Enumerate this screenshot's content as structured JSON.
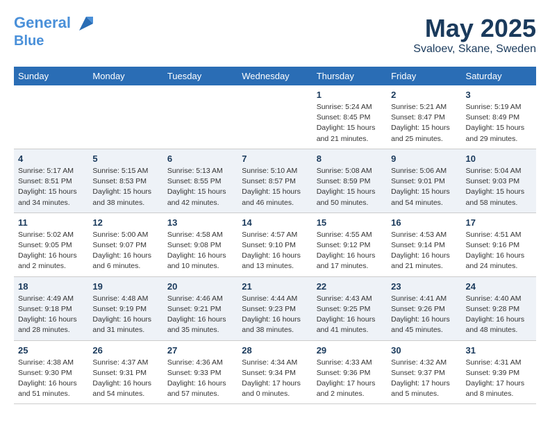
{
  "header": {
    "logo_line1": "General",
    "logo_line2": "Blue",
    "month_title": "May 2025",
    "location": "Svaloev, Skane, Sweden"
  },
  "columns": [
    "Sunday",
    "Monday",
    "Tuesday",
    "Wednesday",
    "Thursday",
    "Friday",
    "Saturday"
  ],
  "weeks": [
    [
      {
        "day": "",
        "info": ""
      },
      {
        "day": "",
        "info": ""
      },
      {
        "day": "",
        "info": ""
      },
      {
        "day": "",
        "info": ""
      },
      {
        "day": "1",
        "info": "Sunrise: 5:24 AM\nSunset: 8:45 PM\nDaylight: 15 hours\nand 21 minutes."
      },
      {
        "day": "2",
        "info": "Sunrise: 5:21 AM\nSunset: 8:47 PM\nDaylight: 15 hours\nand 25 minutes."
      },
      {
        "day": "3",
        "info": "Sunrise: 5:19 AM\nSunset: 8:49 PM\nDaylight: 15 hours\nand 29 minutes."
      }
    ],
    [
      {
        "day": "4",
        "info": "Sunrise: 5:17 AM\nSunset: 8:51 PM\nDaylight: 15 hours\nand 34 minutes."
      },
      {
        "day": "5",
        "info": "Sunrise: 5:15 AM\nSunset: 8:53 PM\nDaylight: 15 hours\nand 38 minutes."
      },
      {
        "day": "6",
        "info": "Sunrise: 5:13 AM\nSunset: 8:55 PM\nDaylight: 15 hours\nand 42 minutes."
      },
      {
        "day": "7",
        "info": "Sunrise: 5:10 AM\nSunset: 8:57 PM\nDaylight: 15 hours\nand 46 minutes."
      },
      {
        "day": "8",
        "info": "Sunrise: 5:08 AM\nSunset: 8:59 PM\nDaylight: 15 hours\nand 50 minutes."
      },
      {
        "day": "9",
        "info": "Sunrise: 5:06 AM\nSunset: 9:01 PM\nDaylight: 15 hours\nand 54 minutes."
      },
      {
        "day": "10",
        "info": "Sunrise: 5:04 AM\nSunset: 9:03 PM\nDaylight: 15 hours\nand 58 minutes."
      }
    ],
    [
      {
        "day": "11",
        "info": "Sunrise: 5:02 AM\nSunset: 9:05 PM\nDaylight: 16 hours\nand 2 minutes."
      },
      {
        "day": "12",
        "info": "Sunrise: 5:00 AM\nSunset: 9:07 PM\nDaylight: 16 hours\nand 6 minutes."
      },
      {
        "day": "13",
        "info": "Sunrise: 4:58 AM\nSunset: 9:08 PM\nDaylight: 16 hours\nand 10 minutes."
      },
      {
        "day": "14",
        "info": "Sunrise: 4:57 AM\nSunset: 9:10 PM\nDaylight: 16 hours\nand 13 minutes."
      },
      {
        "day": "15",
        "info": "Sunrise: 4:55 AM\nSunset: 9:12 PM\nDaylight: 16 hours\nand 17 minutes."
      },
      {
        "day": "16",
        "info": "Sunrise: 4:53 AM\nSunset: 9:14 PM\nDaylight: 16 hours\nand 21 minutes."
      },
      {
        "day": "17",
        "info": "Sunrise: 4:51 AM\nSunset: 9:16 PM\nDaylight: 16 hours\nand 24 minutes."
      }
    ],
    [
      {
        "day": "18",
        "info": "Sunrise: 4:49 AM\nSunset: 9:18 PM\nDaylight: 16 hours\nand 28 minutes."
      },
      {
        "day": "19",
        "info": "Sunrise: 4:48 AM\nSunset: 9:19 PM\nDaylight: 16 hours\nand 31 minutes."
      },
      {
        "day": "20",
        "info": "Sunrise: 4:46 AM\nSunset: 9:21 PM\nDaylight: 16 hours\nand 35 minutes."
      },
      {
        "day": "21",
        "info": "Sunrise: 4:44 AM\nSunset: 9:23 PM\nDaylight: 16 hours\nand 38 minutes."
      },
      {
        "day": "22",
        "info": "Sunrise: 4:43 AM\nSunset: 9:25 PM\nDaylight: 16 hours\nand 41 minutes."
      },
      {
        "day": "23",
        "info": "Sunrise: 4:41 AM\nSunset: 9:26 PM\nDaylight: 16 hours\nand 45 minutes."
      },
      {
        "day": "24",
        "info": "Sunrise: 4:40 AM\nSunset: 9:28 PM\nDaylight: 16 hours\nand 48 minutes."
      }
    ],
    [
      {
        "day": "25",
        "info": "Sunrise: 4:38 AM\nSunset: 9:30 PM\nDaylight: 16 hours\nand 51 minutes."
      },
      {
        "day": "26",
        "info": "Sunrise: 4:37 AM\nSunset: 9:31 PM\nDaylight: 16 hours\nand 54 minutes."
      },
      {
        "day": "27",
        "info": "Sunrise: 4:36 AM\nSunset: 9:33 PM\nDaylight: 16 hours\nand 57 minutes."
      },
      {
        "day": "28",
        "info": "Sunrise: 4:34 AM\nSunset: 9:34 PM\nDaylight: 17 hours\nand 0 minutes."
      },
      {
        "day": "29",
        "info": "Sunrise: 4:33 AM\nSunset: 9:36 PM\nDaylight: 17 hours\nand 2 minutes."
      },
      {
        "day": "30",
        "info": "Sunrise: 4:32 AM\nSunset: 9:37 PM\nDaylight: 17 hours\nand 5 minutes."
      },
      {
        "day": "31",
        "info": "Sunrise: 4:31 AM\nSunset: 9:39 PM\nDaylight: 17 hours\nand 8 minutes."
      }
    ]
  ]
}
